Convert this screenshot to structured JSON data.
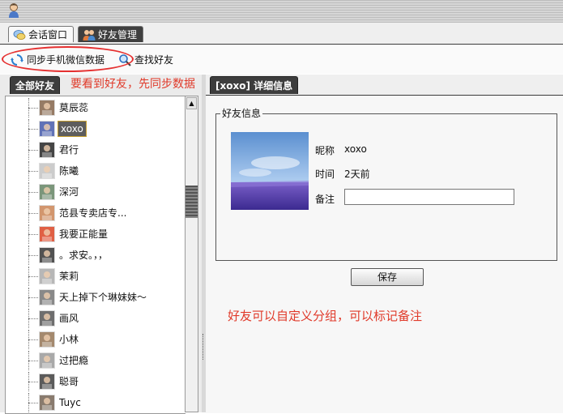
{
  "tabs": [
    {
      "label": "会话窗口",
      "icon": "chat-icon",
      "active": true
    },
    {
      "label": "好友管理",
      "icon": "friends-icon",
      "active": false
    }
  ],
  "toolbar": {
    "sync_label": "同步手机微信数据",
    "sync_icon": "sync-icon",
    "find_label": "查找好友",
    "find_icon": "search-icon"
  },
  "annotations": {
    "sync_hint": "要看到好友，先同步数据",
    "group_hint": "好友可以自定义分组，可以标记备注",
    "color": "#e03a2a"
  },
  "left_panel": {
    "tab_label": "全部好友",
    "friends": [
      {
        "name": "莫辰蕊",
        "selected": false
      },
      {
        "name": "xoxo",
        "selected": true
      },
      {
        "name": "君行",
        "selected": false
      },
      {
        "name": "陈曦",
        "selected": false
      },
      {
        "name": "深河",
        "selected": false
      },
      {
        "name": "范县专卖店专...",
        "selected": false
      },
      {
        "name": "我要正能量",
        "selected": false
      },
      {
        "name": "。求安。，，",
        "selected": false
      },
      {
        "name": "茉莉",
        "selected": false
      },
      {
        "name": "天上掉下个琳妹妹～",
        "selected": false
      },
      {
        "name": "画风",
        "selected": false
      },
      {
        "name": "小林",
        "selected": false
      },
      {
        "name": "过把瘾",
        "selected": false
      },
      {
        "name": "聪哥",
        "selected": false
      },
      {
        "name": "Tuyc",
        "selected": false
      }
    ]
  },
  "detail": {
    "tab_label": "[xoxo] 详细信息",
    "group_title": "好友信息",
    "nickname_label": "昵称",
    "nickname_value": "xoxo",
    "time_label": "时间",
    "time_value": "2天前",
    "remark_label": "备注",
    "remark_value": "",
    "save_label": "保存"
  }
}
